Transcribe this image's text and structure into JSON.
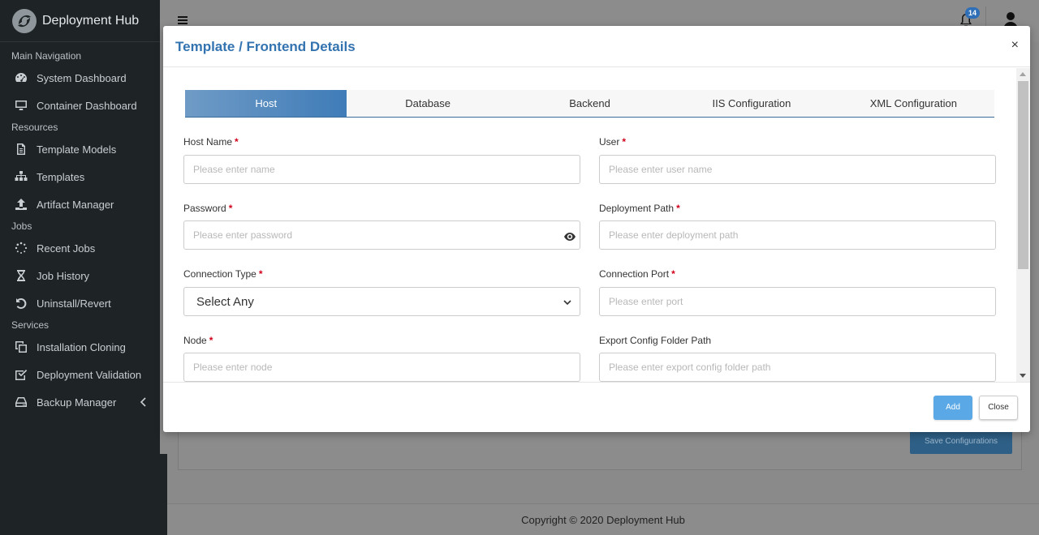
{
  "app": {
    "name": "Deployment Hub"
  },
  "sidebar": {
    "sections": {
      "main": "Main Navigation",
      "resources": "Resources",
      "jobs": "Jobs",
      "services": "Services"
    },
    "items": [
      {
        "label": "System Dashboard",
        "icon": "dashboard-icon"
      },
      {
        "label": "Container Dashboard",
        "icon": "monitor-icon"
      },
      {
        "label": "Template Models",
        "icon": "document-icon"
      },
      {
        "label": "Templates",
        "icon": "sitemap-icon"
      },
      {
        "label": "Artifact Manager",
        "icon": "upload-icon"
      },
      {
        "label": "Recent Jobs",
        "icon": "spinner-icon"
      },
      {
        "label": "Job History",
        "icon": "hourglass-icon"
      },
      {
        "label": "Uninstall/Revert",
        "icon": "undo-icon"
      },
      {
        "label": "Installation Cloning",
        "icon": "clone-icon"
      },
      {
        "label": "Deployment Validation",
        "icon": "checkbox-icon"
      },
      {
        "label": "Backup Manager",
        "icon": "drive-icon"
      }
    ]
  },
  "header": {
    "notification_count": "14"
  },
  "modal": {
    "title": "Template / Frontend Details",
    "close_symbol": "×",
    "tabs": [
      "Host",
      "Database",
      "Backend",
      "IIS Configuration",
      "XML Configuration"
    ],
    "active_tab": "Host",
    "fields": {
      "host_name": {
        "label": "Host Name",
        "placeholder": "Please enter name"
      },
      "user": {
        "label": "User",
        "placeholder": "Please enter user name"
      },
      "password": {
        "label": "Password",
        "placeholder": "Please enter password"
      },
      "deployment_path": {
        "label": "Deployment Path",
        "placeholder": "Please enter deployment path"
      },
      "connection_type": {
        "label": "Connection Type",
        "value": "Select Any"
      },
      "connection_port": {
        "label": "Connection Port",
        "placeholder": "Please enter port"
      },
      "node": {
        "label": "Node",
        "placeholder": "Please enter node"
      },
      "export_config": {
        "label": "Export Config Folder Path",
        "placeholder": "Please enter export config folder path"
      }
    },
    "required_mark": "*",
    "buttons": {
      "add": "Add",
      "close": "Close"
    }
  },
  "background": {
    "save_button": "Save Configurations",
    "footer": "Copyright © 2020 Deployment Hub"
  },
  "colors": {
    "sidebar_bg": "#1e2326",
    "accent": "#3373b0",
    "tab_active": "#3f7cb8",
    "add_button": "#5aa9e6",
    "required": "#d0021b",
    "badge": "#2e6fb7"
  }
}
